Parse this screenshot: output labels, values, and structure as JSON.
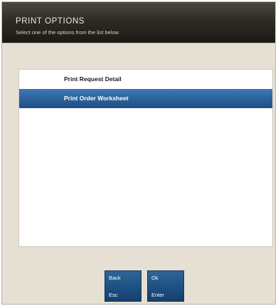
{
  "header": {
    "title": "PRINT OPTIONS",
    "subtitle": "Select one of the options from the list below"
  },
  "list": {
    "items": [
      {
        "label": "Print Request Detail",
        "selected": false
      },
      {
        "label": "Print Order Worksheet",
        "selected": true
      }
    ]
  },
  "buttons": {
    "back": {
      "label": "Back",
      "key": "Esc"
    },
    "ok": {
      "label": "Ok",
      "key": "Enter"
    }
  },
  "colors": {
    "header": "#2f2b24",
    "panel": "#e6dfd3",
    "selection": "#2b609a",
    "button": "#1c4e80"
  }
}
